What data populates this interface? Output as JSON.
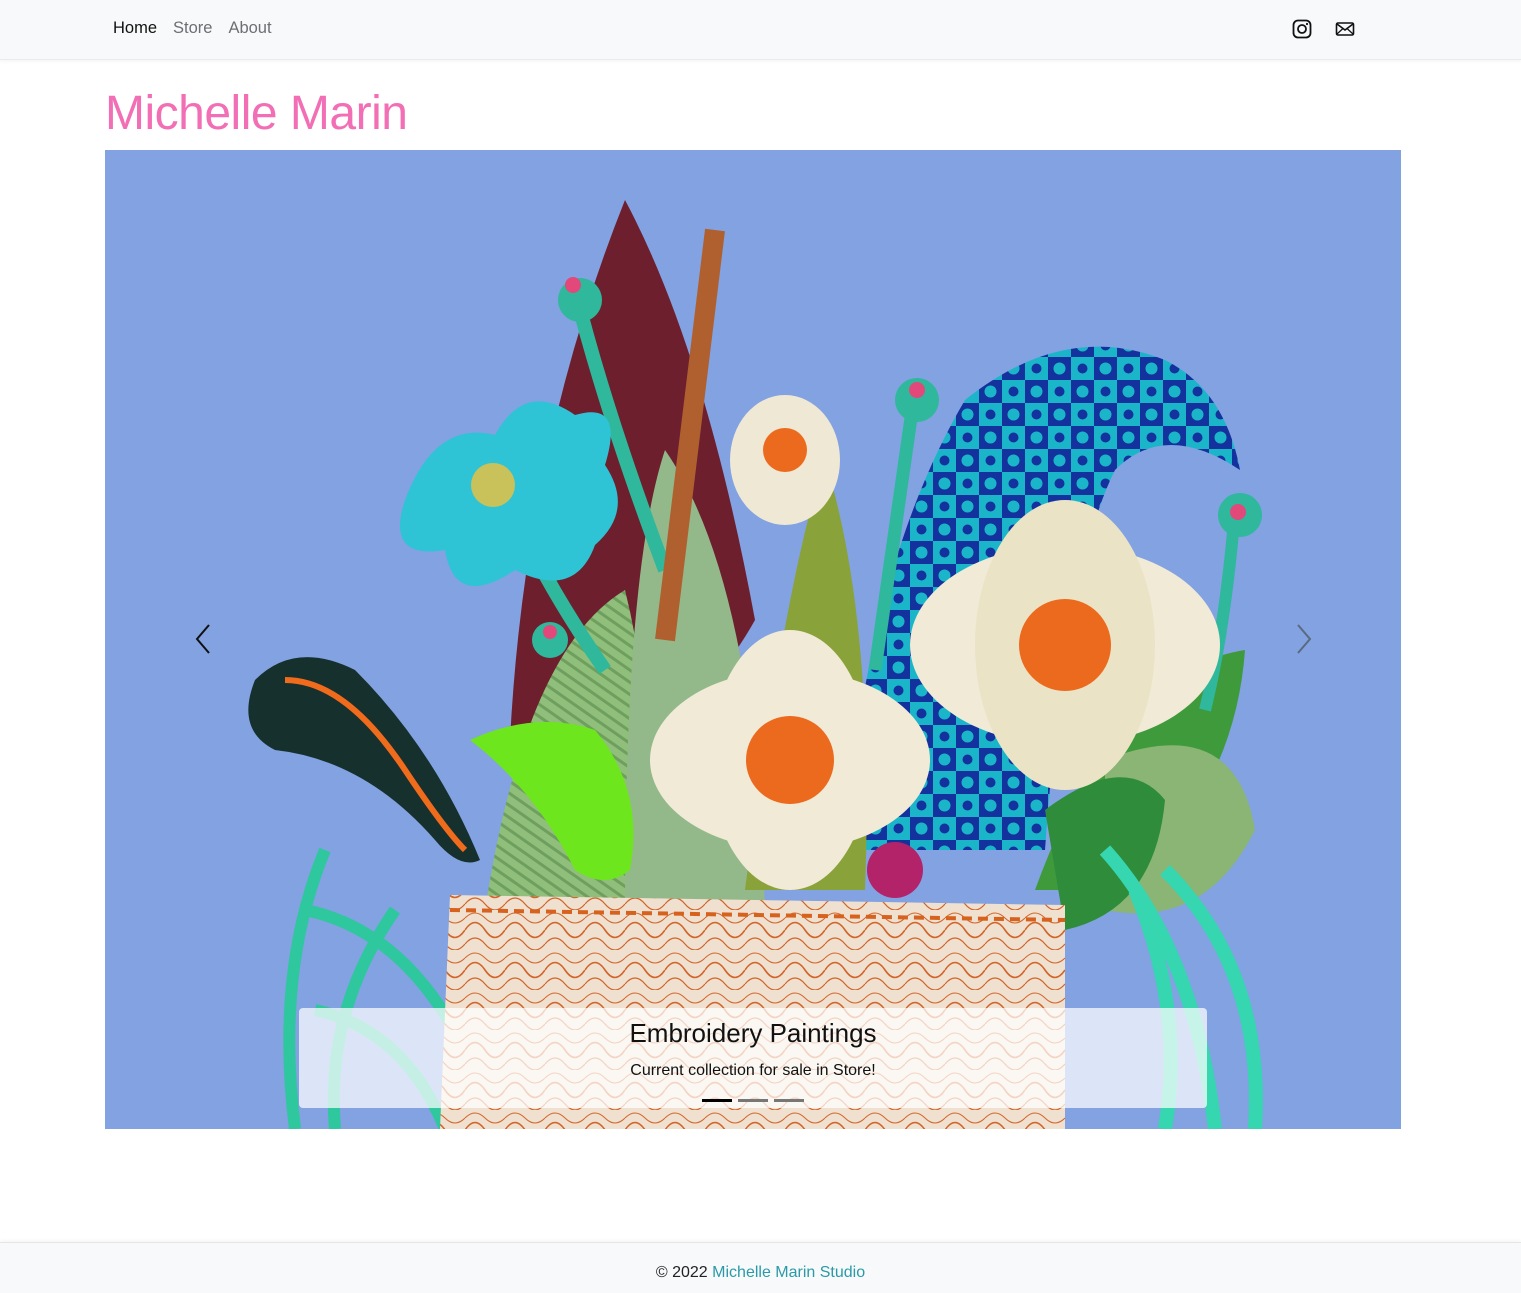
{
  "nav": {
    "links": [
      {
        "label": "Home",
        "active": true
      },
      {
        "label": "Store",
        "active": false
      },
      {
        "label": "About",
        "active": false
      }
    ],
    "icons": [
      "instagram-icon",
      "envelope-icon"
    ]
  },
  "site_title": "Michelle Marin",
  "carousel": {
    "slide_image": "embroidered-flowers-in-vase-painting",
    "caption_title": "Embroidery Paintings",
    "caption_text": "Current collection for sale in Store!",
    "indicator_count": 3,
    "active_indicator": 0,
    "prev_icon": "chevron-left-icon",
    "next_icon": "chevron-right-icon"
  },
  "footer": {
    "copyright": "© 2022",
    "studio_link": "Michelle Marin Studio"
  },
  "colors": {
    "title_pink": "#f26fb6",
    "footer_link": "#2a9aa8",
    "navbar_bg": "#f8f9fa",
    "canvas_blue": "#7f9ee0"
  }
}
